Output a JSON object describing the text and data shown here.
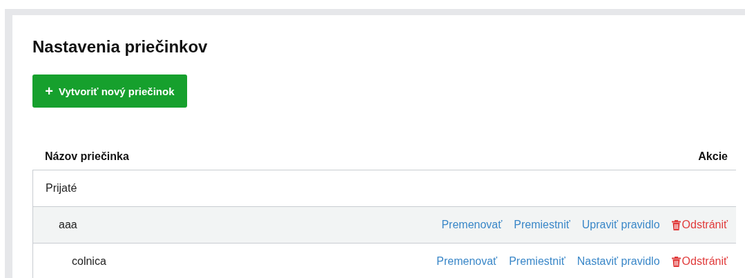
{
  "page": {
    "title": "Nastavenia priečinkov"
  },
  "create_button": {
    "icon": "+",
    "label": "Vytvoriť nový priečinok"
  },
  "table": {
    "columns": [
      "Názov priečinka",
      "Akcie"
    ],
    "rows": [
      {
        "name": "Prijaté",
        "selected": false,
        "children": [
          {
            "name": "aaa",
            "selected": true,
            "actions": [
              {
                "kind": "link",
                "label": "Premenovať"
              },
              {
                "kind": "link",
                "label": "Premiestniť"
              },
              {
                "kind": "link",
                "label": "Upraviť pravidlo"
              },
              {
                "kind": "delete",
                "label": "Odstrániť"
              }
            ],
            "children": [
              {
                "name": "colnica",
                "selected": false,
                "actions": [
                  {
                    "kind": "link",
                    "label": "Premenovať"
                  },
                  {
                    "kind": "link",
                    "label": "Premiestniť"
                  },
                  {
                    "kind": "link",
                    "label": "Nastaviť pravidlo"
                  },
                  {
                    "kind": "delete",
                    "label": "Odstrániť"
                  }
                ]
              }
            ]
          }
        ]
      }
    ]
  }
}
